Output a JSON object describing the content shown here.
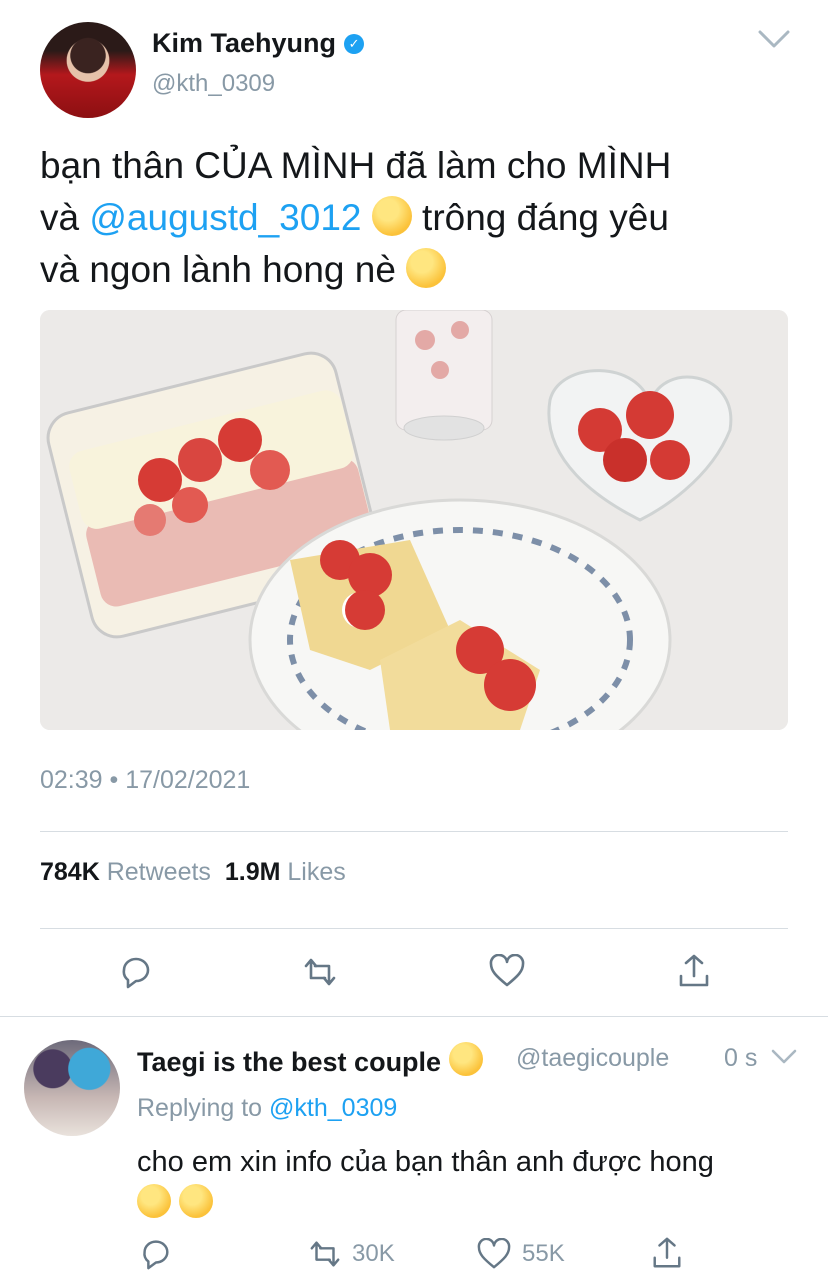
{
  "tweet": {
    "author_name": "Kim Taehyung",
    "author_handle": "@kth_0309",
    "text_line1": "bạn thân CỦA MÌNH đã làm cho MÌNH",
    "text_line2_prefix": "và",
    "mention": "@augustd_3012",
    "text_line2_suffix": "trông đáng yêu",
    "text_line3": "và ngon lành hong nè",
    "timestamp": "02:39 • 17/02/2021",
    "retweets_count": "784K",
    "retweets_label": "Retweets",
    "likes_count": "1.9M",
    "likes_label": "Likes"
  },
  "reply": {
    "author_name": "Taegi is the best couple",
    "author_handle": "@taegicouple",
    "time": "0 s",
    "replying_label": "Replying to",
    "replying_handle": "@kth_0309",
    "text": "cho em xin info của bạn thân anh được hong",
    "retweets": "30K",
    "likes": "55K"
  },
  "icons": {
    "verified": "verified-badge-icon",
    "caret": "chevron-down-icon",
    "reply": "reply-icon",
    "retweet": "retweet-icon",
    "like": "heart-icon",
    "share": "share-icon"
  },
  "colors": {
    "accent": "#1da1f2",
    "muted": "#8899a6",
    "text": "#14171a",
    "divider": "#d7dde2"
  }
}
